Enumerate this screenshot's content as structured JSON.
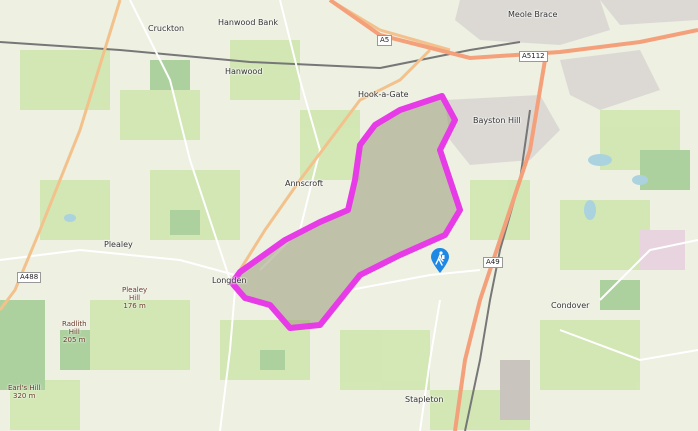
{
  "map": {
    "places": {
      "crucklon": "Cruckton",
      "hanwood_bank": "Hanwood Bank",
      "meole_brace": "Meole Brace",
      "hanwood": "Hanwood",
      "hook_a_gate": "Hook-a-Gate",
      "bayston_hill": "Bayston Hill",
      "annscroft": "Annscroft",
      "pulverbatch": "Plealey",
      "longden": "Longden",
      "condover": "Condover",
      "stapleton": "Stapleton"
    },
    "peaks": {
      "pulley_hill_name": "Plealey",
      "pulley_hill_line2": "Hill",
      "pulley_hill_ele": "176 m",
      "radlith_name": "Radlith",
      "radlith_line2": "Hill",
      "radlith_ele": "205 m",
      "earls_hill_name": "Earl's Hill",
      "earls_hill_ele": "320 m"
    },
    "road_refs": {
      "a5": "A5",
      "a5112": "A5112",
      "a488": "A488",
      "a49": "A49"
    },
    "colors": {
      "highlight": "#e63be6",
      "area_fill": "#9a9a7a",
      "marker": "#1e88e5",
      "trunk_road": "#f4a07a",
      "primary_road": "#fcd6a4"
    },
    "marker_icon": "hiker-icon"
  }
}
